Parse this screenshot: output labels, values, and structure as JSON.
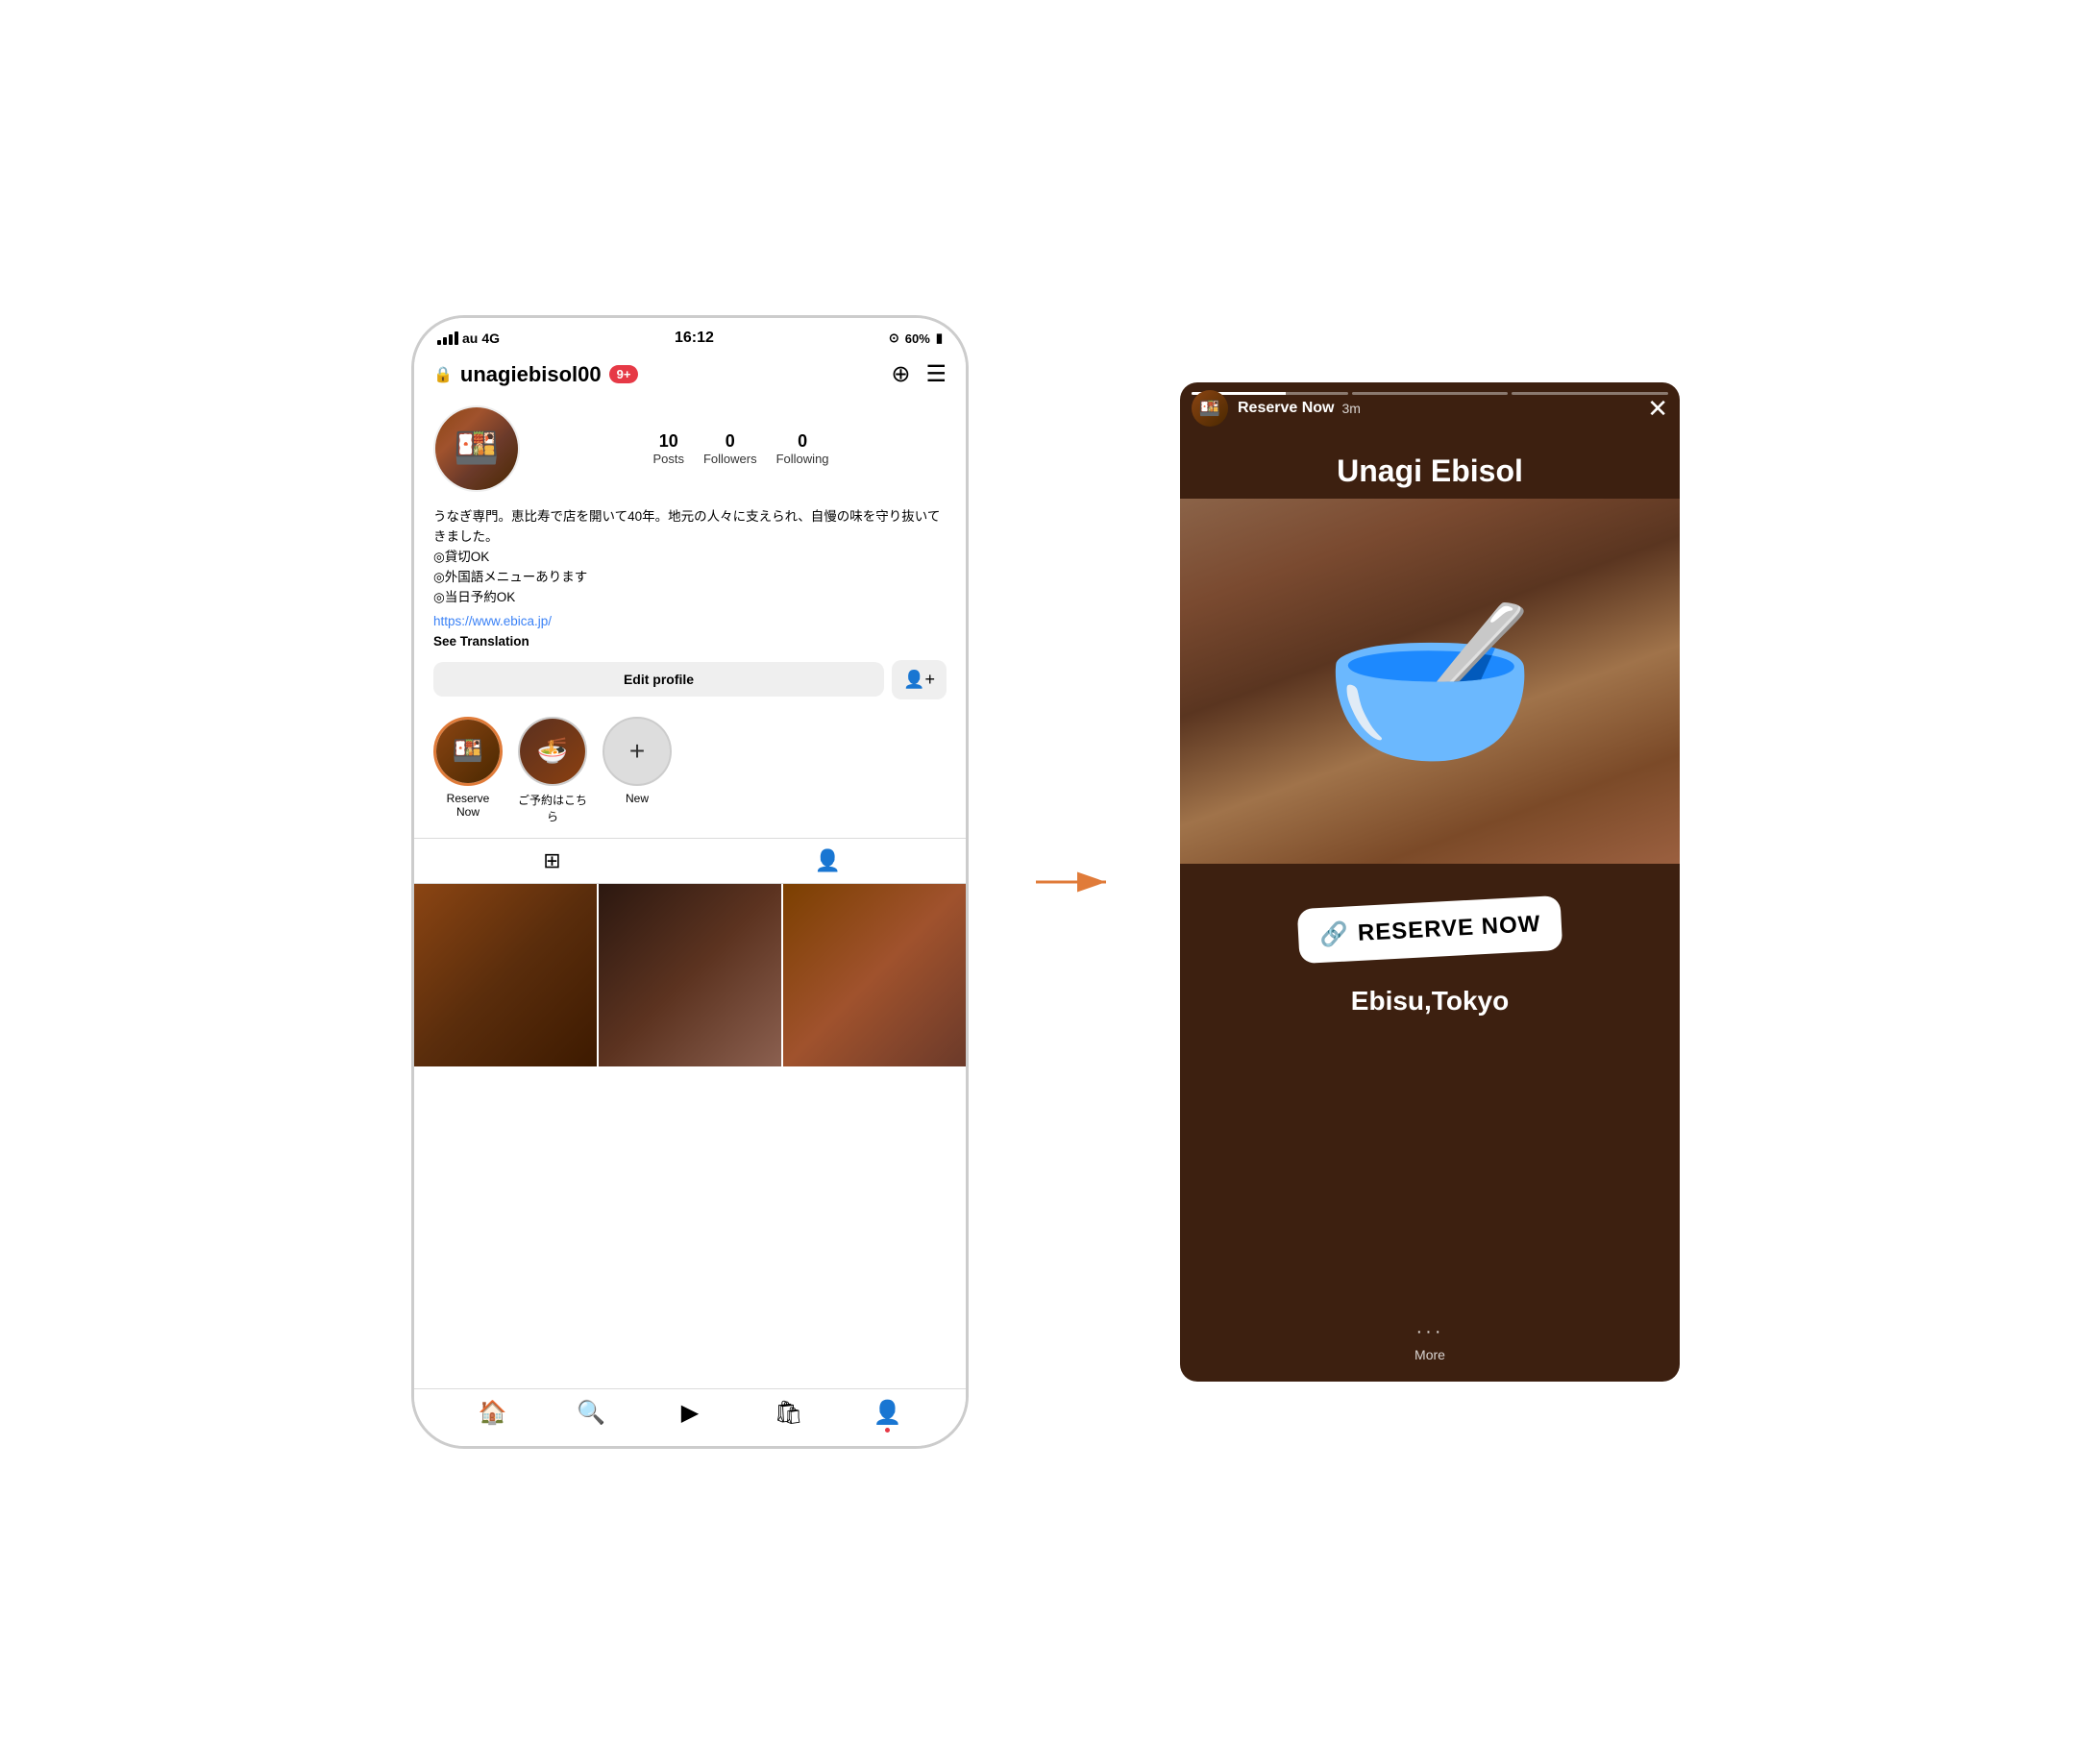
{
  "status_bar": {
    "carrier": "au",
    "network": "4G",
    "time": "16:12",
    "battery": "60%"
  },
  "profile": {
    "lock_icon": "🔒",
    "username": "unagiebisol00",
    "notification_badge": "9+",
    "stats": [
      {
        "number": "10",
        "label": "Posts"
      },
      {
        "number": "0",
        "label": "Followers"
      },
      {
        "number": "0",
        "label": "Following"
      }
    ],
    "bio_line1": "うなぎ専門。恵比寿で店を開いて40年。地元の人々に支えられ、自慢の味を守り抜いてきました。",
    "bio_line2": "◎貸切OK",
    "bio_line3": "◎外国語メニューあります",
    "bio_line4": "◎当日予約OK",
    "link": "https://www.ebica.jp/",
    "see_translation": "See Translation",
    "edit_profile_btn": "Edit profile"
  },
  "highlights": [
    {
      "label": "Reserve Now",
      "type": "food",
      "active": true
    },
    {
      "label": "ご予約はこちら",
      "type": "food2",
      "active": false
    },
    {
      "label": "New",
      "type": "new",
      "active": false
    }
  ],
  "story": {
    "account_name": "Reserve Now",
    "time": "3m",
    "close_icon": "✕",
    "title": "Unagi Ebisol",
    "reserve_text": "RESERVE NOW",
    "location": "Ebisu,Tokyo",
    "more_label": "More",
    "dots": "···"
  },
  "bottom_nav": {
    "items": [
      "home",
      "search",
      "reels",
      "shop",
      "profile"
    ]
  }
}
